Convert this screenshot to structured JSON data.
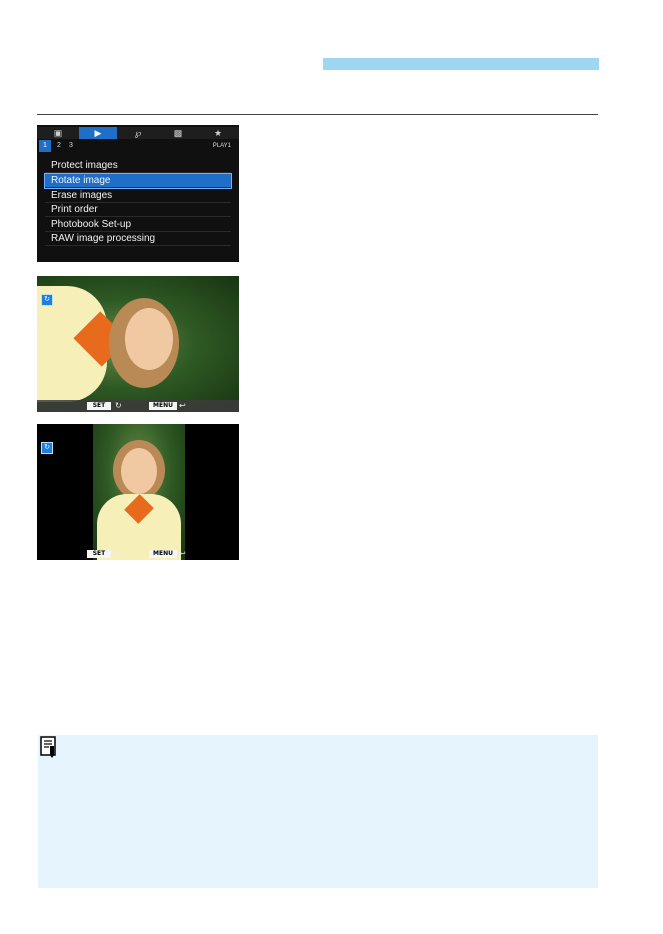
{
  "header": {
    "accent_color": "#9fd7f2"
  },
  "menu": {
    "tabs": [
      {
        "icon": "camera-icon"
      },
      {
        "icon": "playback-icon",
        "active": true
      },
      {
        "icon": "wrench-icon"
      },
      {
        "icon": "person-icon"
      },
      {
        "icon": "star-icon"
      }
    ],
    "pages": [
      "1",
      "2",
      "3"
    ],
    "page_name": "PLAY1",
    "items": [
      "Protect images",
      "Rotate image",
      "Erase images",
      "Print order",
      "Photobook Set-up",
      "RAW image processing"
    ],
    "selected_item": "Rotate image",
    "accent_color": "#1f6ec7"
  },
  "photo_screens": {
    "set_key": "SET",
    "menu_key": "MENU"
  },
  "note": {
    "icon": "memo-icon",
    "background": "#e6f4fd"
  }
}
